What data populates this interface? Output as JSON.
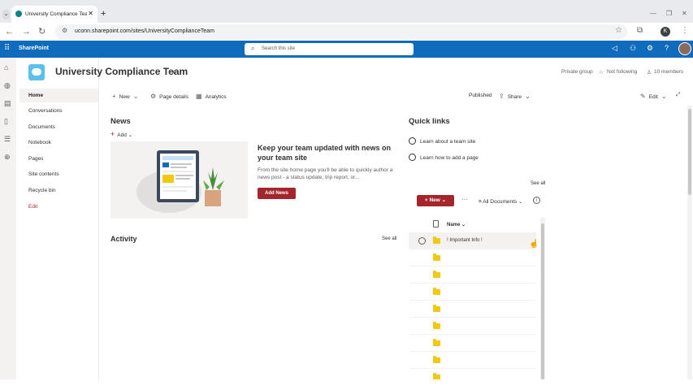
{
  "browser": {
    "tab_title": "University Compliance Team",
    "tab_close": "✕",
    "new_tab": "+",
    "url": "uconn.sharepoint.com/sites/UniversityComplianceTeam",
    "profile_initial": "K",
    "icons": [
      "back-arrow-icon",
      "forward-arrow-icon",
      "reload-icon",
      "tune-icon",
      "bookmark-star-icon",
      "extensions-icon",
      "kebab-menu-icon"
    ]
  },
  "suitebar": {
    "brand": "SharePoint",
    "search_placeholder": "Search this site",
    "color": "#0f6cbd"
  },
  "site": {
    "title": "University Compliance Team",
    "group_type": "Private group",
    "follow_label": "Not following",
    "members": "10 members"
  },
  "leftnav": {
    "items": [
      {
        "label": "Home"
      },
      {
        "label": "Conversations"
      },
      {
        "label": "Documents"
      },
      {
        "label": "Notebook"
      },
      {
        "label": "Pages"
      },
      {
        "label": "Site contents"
      },
      {
        "label": "Recycle bin"
      },
      {
        "label": "Edit"
      }
    ]
  },
  "commandbar": {
    "new": "New",
    "page_details": "Page details",
    "analytics": "Analytics",
    "published": "Published",
    "share": "Share",
    "edit": "Edit"
  },
  "news": {
    "heading": "News",
    "add": "Add",
    "promo_title": "Keep your team updated with news on your team site",
    "promo_body": "From the site home page you'll be able to quickly author a news post - a status update, trip report, or...",
    "add_news": "Add News"
  },
  "activity": {
    "heading": "Activity",
    "see_all": "See all"
  },
  "quicklinks": {
    "heading": "Quick links",
    "links": [
      {
        "label": "Learn about a team site"
      },
      {
        "label": "Learn how to add a page"
      }
    ],
    "see_all": "See all"
  },
  "documents": {
    "new": "New",
    "more": "···",
    "view": "All Documents",
    "info": "i",
    "name_header": "Name",
    "rows": [
      {
        "name": "! Important Info !"
      },
      {
        "name": ""
      },
      {
        "name": ""
      },
      {
        "name": ""
      },
      {
        "name": ""
      },
      {
        "name": ""
      },
      {
        "name": ""
      },
      {
        "name": ""
      },
      {
        "name": ""
      }
    ],
    "accent": "#a4262c"
  }
}
